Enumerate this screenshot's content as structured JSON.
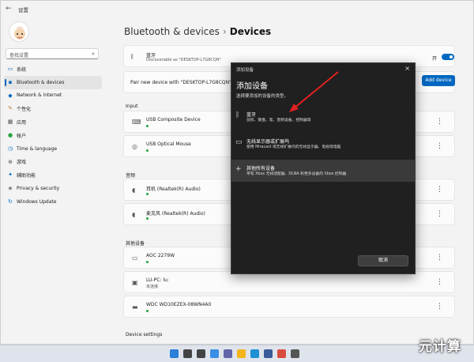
{
  "window": {
    "title": "设置",
    "back_glyph": "←"
  },
  "sidebar": {
    "search_placeholder": "查找设置",
    "items": [
      {
        "label": "系统",
        "icon": "monitor-icon",
        "glyph": "▭",
        "color": "#0067c0"
      },
      {
        "label": "Bluetooth & devices",
        "icon": "bluetooth-devices-icon",
        "glyph": "▪",
        "color": "#0067c0",
        "active": true
      },
      {
        "label": "Network & internet",
        "icon": "network-icon",
        "glyph": "◆",
        "color": "#0067c0"
      },
      {
        "label": "个性化",
        "icon": "brush-icon",
        "glyph": "✎",
        "color": "#c57a2a"
      },
      {
        "label": "应用",
        "icon": "apps-icon",
        "glyph": "▦",
        "color": "#555555"
      },
      {
        "label": "帐户",
        "icon": "account-icon",
        "glyph": "●",
        "color": "#23a23a"
      },
      {
        "label": "Time & language",
        "icon": "clock-icon",
        "glyph": "◷",
        "color": "#0067c0"
      },
      {
        "label": "游戏",
        "icon": "gamepad-icon",
        "glyph": "⊕",
        "color": "#555555"
      },
      {
        "label": "辅助功能",
        "icon": "accessibility-icon",
        "glyph": "✦",
        "color": "#0067c0"
      },
      {
        "label": "Privacy & security",
        "icon": "shield-icon",
        "glyph": "◈",
        "color": "#666666"
      },
      {
        "label": "Windows Update",
        "icon": "update-icon",
        "glyph": "↻",
        "color": "#0067c0"
      }
    ]
  },
  "main": {
    "breadcrumb_parent": "Bluetooth & devices",
    "breadcrumb_sep": "›",
    "breadcrumb_current": "Devices",
    "bluetooth": {
      "name": "蓝牙",
      "sub": "Discoverable as \"DESKTOP-L7G8CQN\"",
      "state_label": "开",
      "enabled": true
    },
    "pair_text": "Pair new device with \"DESKTOP-L7G8CQN\"",
    "add_device_label": "Add device",
    "sections": {
      "input": "Input",
      "audio": "音频",
      "other": "其他设备",
      "settings": "Device settings"
    },
    "input_devices": [
      {
        "name": "USB Composite Device",
        "icon": "keyboard-icon",
        "glyph": "⌨",
        "status": ""
      },
      {
        "name": "USB Optical Mouse",
        "icon": "mouse-icon",
        "glyph": "◎",
        "status": ""
      }
    ],
    "audio_devices": [
      {
        "name": "耳机 (Realtek(R) Audio)",
        "icon": "headphones-icon",
        "glyph": "◖",
        "status": ""
      },
      {
        "name": "麦克风 (Realtek(R) Audio)",
        "icon": "microphone-icon",
        "glyph": "◖",
        "status": ""
      }
    ],
    "other_devices": [
      {
        "name": "AOC 2279W",
        "icon": "monitor-device-icon",
        "glyph": "▭",
        "status": ""
      },
      {
        "name": "LU-PC: lu:",
        "icon": "media-device-icon",
        "glyph": "▣",
        "status": "未连接"
      },
      {
        "name": "WDC WD10EZEX-08WN4A0",
        "icon": "drive-icon",
        "glyph": "▬",
        "status": ""
      }
    ],
    "more_glyph": "⋮"
  },
  "dialog": {
    "title": "添加设备",
    "close_glyph": "×",
    "heading": "添加设备",
    "subtitle": "选择要添加的设备的类型。",
    "options": [
      {
        "title": "蓝牙",
        "desc": "鼠标、键盘、笔、音频设备、控制器等",
        "icon": "bluetooth-icon",
        "glyph": "ᛒ"
      },
      {
        "title": "无线显示器或扩展坞",
        "desc": "使用 Miracast 或无线扩展坞的无线显示器、电视或电脑",
        "icon": "display-icon",
        "glyph": "▭"
      },
      {
        "title": "其他所有设备",
        "desc": "带有 Xbox 无线适配器、DLNA 和更多设备的 Xbox 控制器",
        "icon": "plus-icon",
        "glyph": "+"
      }
    ],
    "cancel_label": "取消"
  },
  "taskbar": {
    "icons": [
      {
        "name": "start-icon",
        "color": "#2b7fd9"
      },
      {
        "name": "search-icon",
        "color": "#444444"
      },
      {
        "name": "task-view-icon",
        "color": "#444444"
      },
      {
        "name": "widgets-icon",
        "color": "#3a8ee6"
      },
      {
        "name": "chat-icon",
        "color": "#6264a7"
      },
      {
        "name": "file-explorer-icon",
        "color": "#f2b51a"
      },
      {
        "name": "edge-icon",
        "color": "#1f8fd6"
      },
      {
        "name": "store-icon",
        "color": "#3b5998"
      },
      {
        "name": "chrome-icon",
        "color": "#d94b3f"
      },
      {
        "name": "settings-icon",
        "color": "#555555"
      }
    ]
  },
  "watermark": "元计算",
  "accent_color": "#0067c0",
  "arrow_color": "#e02020"
}
